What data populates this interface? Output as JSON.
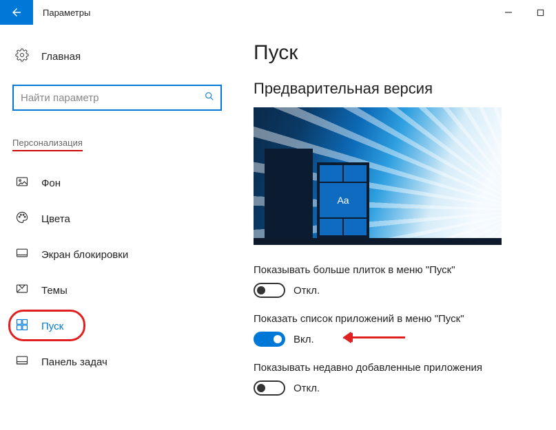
{
  "window": {
    "title": "Параметры"
  },
  "sidebar": {
    "home": "Главная",
    "search_placeholder": "Найти параметр",
    "category": "Персонализация",
    "items": [
      {
        "key": "background",
        "label": "Фон"
      },
      {
        "key": "colors",
        "label": "Цвета"
      },
      {
        "key": "lockscreen",
        "label": "Экран блокировки"
      },
      {
        "key": "themes",
        "label": "Темы"
      },
      {
        "key": "start",
        "label": "Пуск"
      },
      {
        "key": "taskbar",
        "label": "Панель задач"
      }
    ]
  },
  "main": {
    "title": "Пуск",
    "preview_heading": "Предварительная версия",
    "preview_tile_text": "Aa",
    "settings": [
      {
        "label": "Показывать больше плиток в меню \"Пуск\"",
        "on": false,
        "state": "Откл."
      },
      {
        "label": "Показать список приложений в меню \"Пуск\"",
        "on": true,
        "state": "Вкл."
      },
      {
        "label": "Показывать недавно добавленные приложения",
        "on": false,
        "state": "Откл."
      }
    ]
  }
}
